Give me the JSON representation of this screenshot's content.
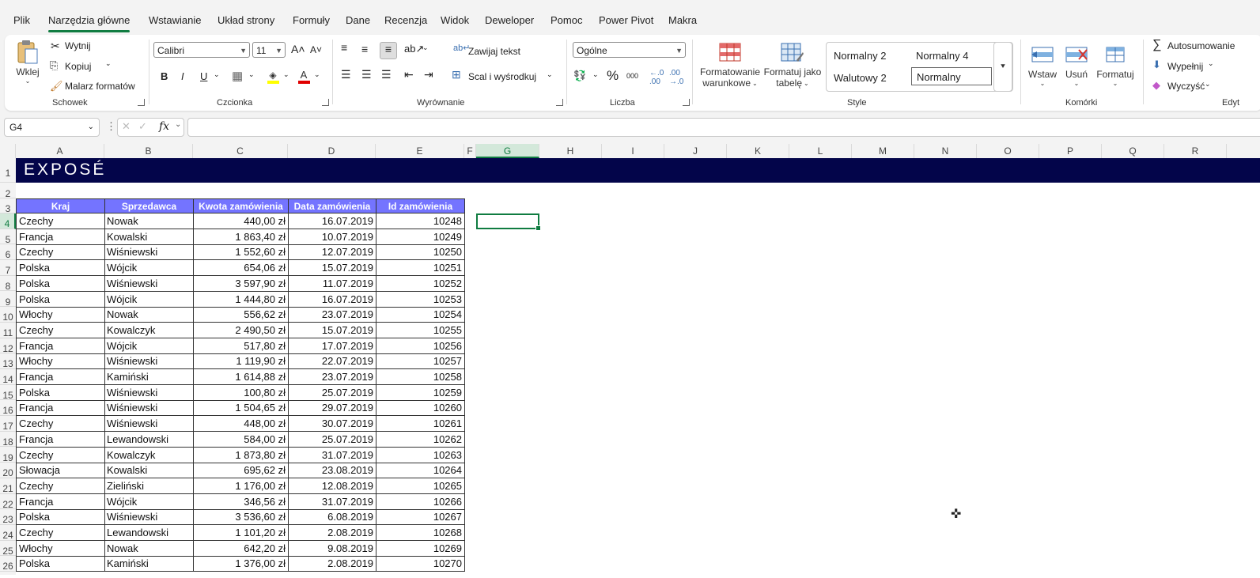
{
  "menu": {
    "tabs": [
      "Plik",
      "Narzędzia główne",
      "Wstawianie",
      "Układ strony",
      "Formuły",
      "Dane",
      "Recenzja",
      "Widok",
      "Deweloper",
      "Pomoc",
      "Power Pivot",
      "Makra"
    ],
    "active": "Narzędzia główne"
  },
  "ribbon": {
    "clipboard": {
      "paste": "Wklej",
      "cut": "Wytnij",
      "copy": "Kopiuj",
      "painter": "Malarz formatów",
      "label": "Schowek"
    },
    "font": {
      "name": "Calibri",
      "size": "11",
      "bold": "B",
      "italic": "I",
      "underline": "U",
      "label": "Czcionka",
      "fill_color": "#ffff00",
      "font_color": "#e00000"
    },
    "alignment": {
      "wrap": "Zawijaj tekst",
      "merge": "Scal i wyśrodkuj",
      "label": "Wyrównanie"
    },
    "number": {
      "format": "Ogólne",
      "percent": "%",
      "thousands": "000",
      "label": "Liczba"
    },
    "styles": {
      "conditional": [
        "Formatowanie",
        "warunkowe"
      ],
      "table": [
        "Formatuj jako",
        "tabelę"
      ],
      "gallery": [
        "Normalny 2",
        "Normalny 4",
        "Walutowy 2",
        "Normalny"
      ],
      "label": "Style"
    },
    "cells": {
      "insert": "Wstaw",
      "delete": "Usuń",
      "format": "Formatuj",
      "label": "Komórki"
    },
    "editing": {
      "autosum": "Autosumowanie",
      "fill": "Wypełnij",
      "clear": "Wyczyść",
      "label": "Edyt"
    }
  },
  "formula_bar": {
    "name_box": "G4",
    "fx": "fx",
    "formula": ""
  },
  "sheet": {
    "columns": [
      "A",
      "B",
      "C",
      "D",
      "E",
      "F",
      "G",
      "H",
      "I",
      "J",
      "K",
      "L",
      "M",
      "N",
      "O",
      "P",
      "Q",
      "R"
    ],
    "selected_column": "G",
    "selected_row": "4",
    "rows": [
      "1",
      "2",
      "3",
      "4",
      "5",
      "6",
      "7",
      "8",
      "9",
      "10",
      "11",
      "12",
      "13",
      "14",
      "15",
      "16",
      "17",
      "18",
      "19",
      "20",
      "21",
      "22",
      "23",
      "24",
      "25",
      "26"
    ],
    "banner_text": "EXPOSÉ",
    "banner_color": "#03054a",
    "header_color": "#7474ff",
    "table": {
      "headers": [
        "Kraj",
        "Sprzedawca",
        "Kwota zamówienia",
        "Data zamówienia",
        "Id zamówienia"
      ],
      "rows": [
        [
          "Czechy",
          "Nowak",
          "440,00 zł",
          "16.07.2019",
          "10248"
        ],
        [
          "Francja",
          "Kowalski",
          "1 863,40 zł",
          "10.07.2019",
          "10249"
        ],
        [
          "Czechy",
          "Wiśniewski",
          "1 552,60 zł",
          "12.07.2019",
          "10250"
        ],
        [
          "Polska",
          "Wójcik",
          "654,06 zł",
          "15.07.2019",
          "10251"
        ],
        [
          "Polska",
          "Wiśniewski",
          "3 597,90 zł",
          "11.07.2019",
          "10252"
        ],
        [
          "Polska",
          "Wójcik",
          "1 444,80 zł",
          "16.07.2019",
          "10253"
        ],
        [
          "Włochy",
          "Nowak",
          "556,62 zł",
          "23.07.2019",
          "10254"
        ],
        [
          "Czechy",
          "Kowalczyk",
          "2 490,50 zł",
          "15.07.2019",
          "10255"
        ],
        [
          "Francja",
          "Wójcik",
          "517,80 zł",
          "17.07.2019",
          "10256"
        ],
        [
          "Włochy",
          "Wiśniewski",
          "1 119,90 zł",
          "22.07.2019",
          "10257"
        ],
        [
          "Francja",
          "Kamiński",
          "1 614,88 zł",
          "23.07.2019",
          "10258"
        ],
        [
          "Polska",
          "Wiśniewski",
          "100,80 zł",
          "25.07.2019",
          "10259"
        ],
        [
          "Francja",
          "Wiśniewski",
          "1 504,65 zł",
          "29.07.2019",
          "10260"
        ],
        [
          "Czechy",
          "Wiśniewski",
          "448,00 zł",
          "30.07.2019",
          "10261"
        ],
        [
          "Francja",
          "Lewandowski",
          "584,00 zł",
          "25.07.2019",
          "10262"
        ],
        [
          "Czechy",
          "Kowalczyk",
          "1 873,80 zł",
          "31.07.2019",
          "10263"
        ],
        [
          "Słowacja",
          "Kowalski",
          "695,62 zł",
          "23.08.2019",
          "10264"
        ],
        [
          "Czechy",
          "Zieliński",
          "1 176,00 zł",
          "12.08.2019",
          "10265"
        ],
        [
          "Francja",
          "Wójcik",
          "346,56 zł",
          "31.07.2019",
          "10266"
        ],
        [
          "Polska",
          "Wiśniewski",
          "3 536,60 zł",
          "6.08.2019",
          "10267"
        ],
        [
          "Czechy",
          "Lewandowski",
          "1 101,20 zł",
          "2.08.2019",
          "10268"
        ],
        [
          "Włochy",
          "Nowak",
          "642,20 zł",
          "9.08.2019",
          "10269"
        ],
        [
          "Polska",
          "Kamiński",
          "1 376,00 zł",
          "2.08.2019",
          "10270"
        ]
      ]
    }
  }
}
